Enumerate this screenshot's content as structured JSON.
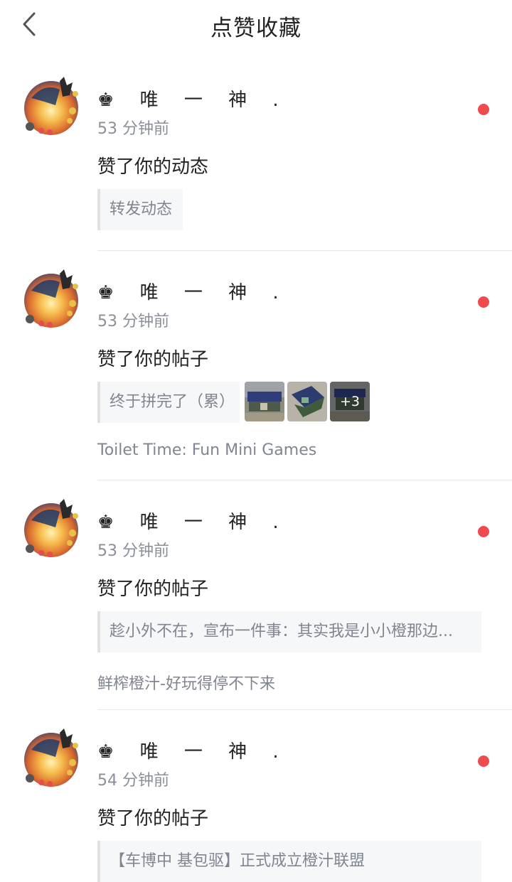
{
  "header": {
    "title": "点赞收藏",
    "back_icon": "chevron-left-icon"
  },
  "items": [
    {
      "user_name": "♚ 唯 一 神 .",
      "time": "53 分钟前",
      "action": "赞了你的动态",
      "quote": "转发动态",
      "unread": true
    },
    {
      "user_name": "♚ 唯 一 神 .",
      "time": "53 分钟前",
      "action": "赞了你的帖子",
      "quote": "终于拼完了（累）",
      "thumbnails_more": "+3",
      "source": "Toilet Time: Fun Mini Games",
      "unread": true
    },
    {
      "user_name": "♚ 唯 一 神 .",
      "time": "53 分钟前",
      "action": "赞了你的帖子",
      "quote": "趁小外不在，宣布一件事：其实我是小小橙那边...",
      "source": "鲜榨橙汁-好玩得停不下来",
      "unread": true
    },
    {
      "user_name": "♚ 唯 一 神 .",
      "time": "54 分钟前",
      "action": "赞了你的帖子",
      "quote": "【车博中 基包驱】正式成立橙汁联盟",
      "unread": true
    }
  ],
  "colors": {
    "unread_dot": "#ee4b4f",
    "secondary_text": "#8a8f99",
    "quote_bg": "#f6f7f9"
  }
}
